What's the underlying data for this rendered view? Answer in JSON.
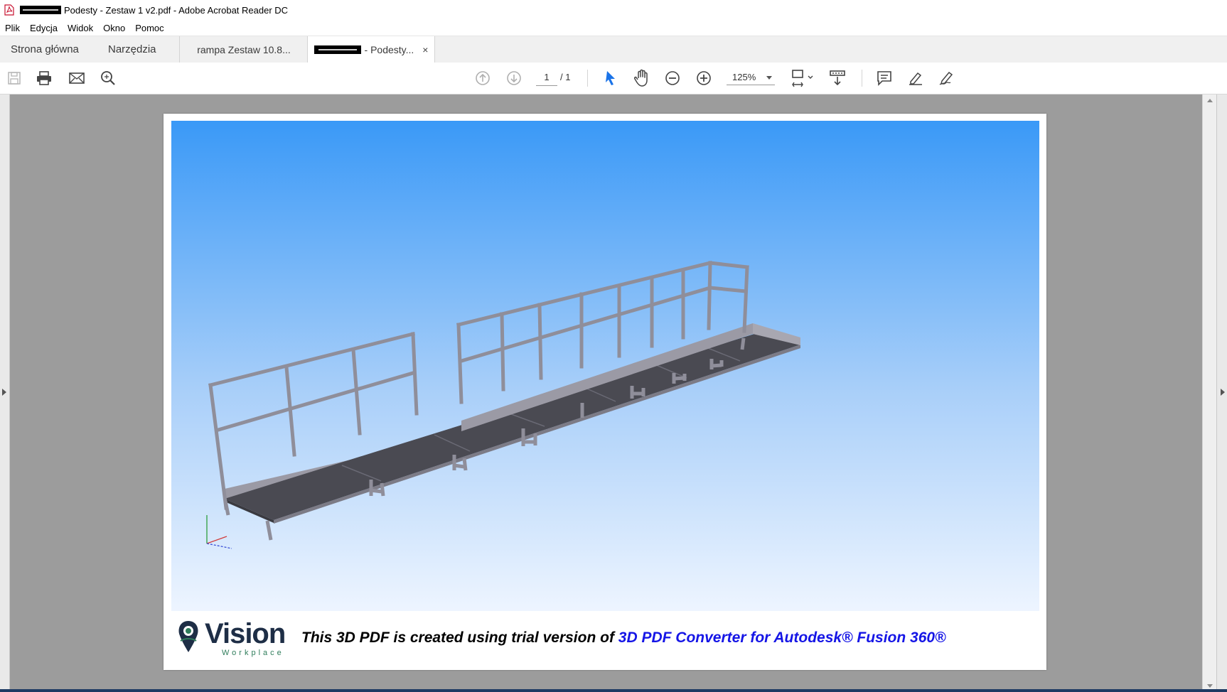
{
  "window": {
    "title": "Podesty - Zestaw 1 v2.pdf - Adobe Acrobat Reader DC"
  },
  "menu": [
    "Plik",
    "Edycja",
    "Widok",
    "Okno",
    "Pomoc"
  ],
  "tabs": {
    "home": "Strona główna",
    "tools": "Narzędzia",
    "doc1": "rampa Zestaw 10.8...",
    "doc2": "- Podesty...",
    "close_glyph": "×"
  },
  "toolbar": {
    "page_current": "1",
    "page_total": "/ 1",
    "zoom": "125%",
    "icons": [
      "save-icon",
      "print-icon",
      "email-icon",
      "search-icon",
      "previous-page-icon",
      "next-page-icon",
      "select-cursor-icon",
      "hand-icon",
      "zoom-out-icon",
      "zoom-in-icon",
      "fit-page-icon",
      "scroll-mode-icon",
      "comment-icon",
      "highlight-icon",
      "sign-icon"
    ],
    "accent": "#1a73e8"
  },
  "document": {
    "trial_text_black": "This 3D PDF is created using trial version of",
    "trial_text_blue": "3D PDF Converter for Autodesk® Fusion 360®",
    "logo_word": "Vision",
    "logo_sub": "Workplace",
    "sky_top": "#3a99f7",
    "sky_bottom": "#eef5ff"
  }
}
